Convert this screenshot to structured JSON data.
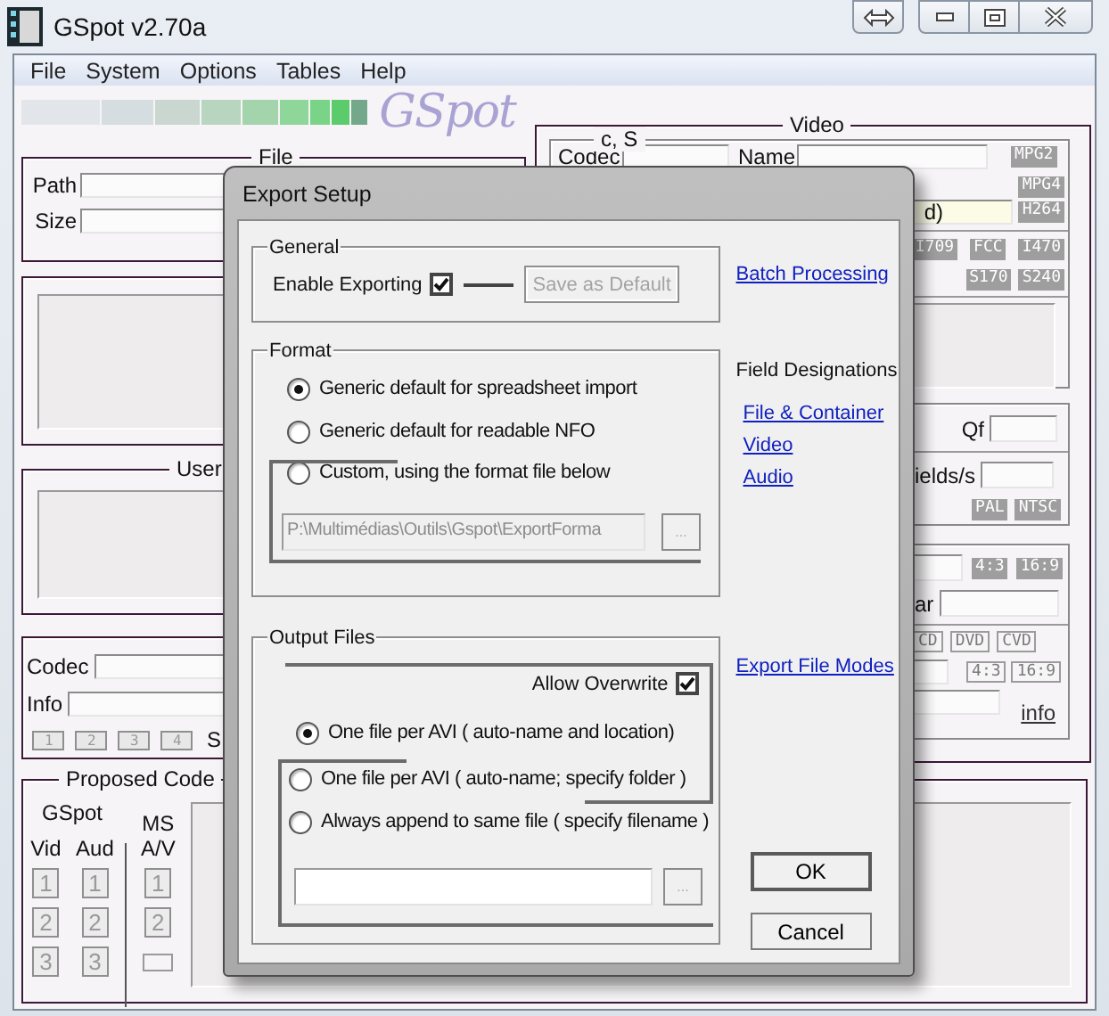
{
  "window": {
    "title": "GSpot v2.70a"
  },
  "menu": [
    "File",
    "System",
    "Options",
    "Tables",
    "Help"
  ],
  "logo": "GSpot",
  "file_group": {
    "legend": "File",
    "fields": [
      {
        "label": "Path"
      },
      {
        "label": "Size"
      }
    ]
  },
  "user_group": {
    "legend": "User"
  },
  "codec_group": {
    "fields": [
      {
        "label": "Codec"
      },
      {
        "label": "Info"
      }
    ],
    "buttons": [
      "1",
      "2",
      "3",
      "4"
    ],
    "trailing_label": "S"
  },
  "proposed_group": {
    "legend": "Proposed Code",
    "gspot": {
      "title": "GSpot",
      "columns": [
        {
          "label": "Vid",
          "buttons": [
            "1",
            "2",
            "3"
          ]
        },
        {
          "label": "Aud",
          "buttons": [
            "1",
            "2",
            "3"
          ]
        }
      ]
    },
    "ms": {
      "title": "MS",
      "label": "A/V",
      "buttons": [
        "1",
        "2"
      ]
    }
  },
  "video_group": {
    "legend": "Video",
    "codec_section": {
      "legend": "c, S",
      "codec_label": "Codec",
      "name_label": "Name",
      "codec_name": "d)",
      "format_tags": [
        {
          "label": "MPG2",
          "kind": "flag"
        },
        {
          "label": "MPG4",
          "kind": "flag"
        },
        {
          "label": "H264",
          "kind": "flag"
        }
      ],
      "matrix_tags": [
        {
          "label": "I709",
          "kind": "flag"
        },
        {
          "label": "FCC",
          "kind": "flag"
        },
        {
          "label": "I470",
          "kind": "flag"
        }
      ],
      "range_tags": [
        {
          "label": "S170",
          "kind": "flag"
        },
        {
          "label": "S240",
          "kind": "flag"
        }
      ]
    },
    "rate_section": {
      "qf_label": "Qf",
      "fields_label": "ields/s",
      "standard_tags": [
        {
          "label": "PAL",
          "kind": "flag"
        },
        {
          "label": "NTSC",
          "kind": "flag"
        }
      ]
    },
    "aspect_section": {
      "ar_label": "ar",
      "info_link": "info",
      "aspect_tags": [
        {
          "label": "4:3",
          "kind": "flag"
        },
        {
          "label": "16:9",
          "kind": "flag"
        }
      ],
      "disc_tags": [
        {
          "label": "CD",
          "kind": "button"
        },
        {
          "label": "DVD",
          "kind": "button"
        },
        {
          "label": "CVD",
          "kind": "button"
        }
      ],
      "ratio_tags": [
        {
          "label": "4:3",
          "kind": "button"
        },
        {
          "label": "16:9",
          "kind": "button"
        }
      ]
    }
  },
  "dialog": {
    "title": "Export Setup",
    "general": {
      "legend": "General",
      "enable": {
        "label": "Enable Exporting",
        "checked": true
      },
      "save_default": {
        "label": "Save as Default",
        "disabled": true
      }
    },
    "format": {
      "legend": "Format",
      "options": [
        {
          "label": "Generic default for spreadsheet import",
          "selected": true
        },
        {
          "label": "Generic default for readable NFO",
          "selected": false
        },
        {
          "label": "Custom, using the format file below",
          "selected": false
        }
      ],
      "file": {
        "value": "P:\\Multimédias\\Outils\\Gspot\\ExportForma",
        "disabled": true
      },
      "browse": "..."
    },
    "output": {
      "legend": "Output Files",
      "allow_overwrite": {
        "label": "Allow Overwrite",
        "checked": true
      },
      "options": [
        {
          "label": "One file per AVI ( auto-name and location)",
          "selected": true
        },
        {
          "label": "One file per AVI ( auto-name; specify folder )",
          "selected": false
        },
        {
          "label": "Always append to same file ( specify filename )",
          "selected": false
        }
      ],
      "browse": "..."
    },
    "batch_link": "Batch Processing",
    "field_designations": {
      "title": "Field Designations",
      "links": [
        "File & Container",
        "Video",
        "Audio"
      ]
    },
    "modes_link": "Export File Modes",
    "buttons": [
      {
        "label": "OK",
        "default": true
      },
      {
        "label": "Cancel",
        "default": false
      }
    ]
  }
}
